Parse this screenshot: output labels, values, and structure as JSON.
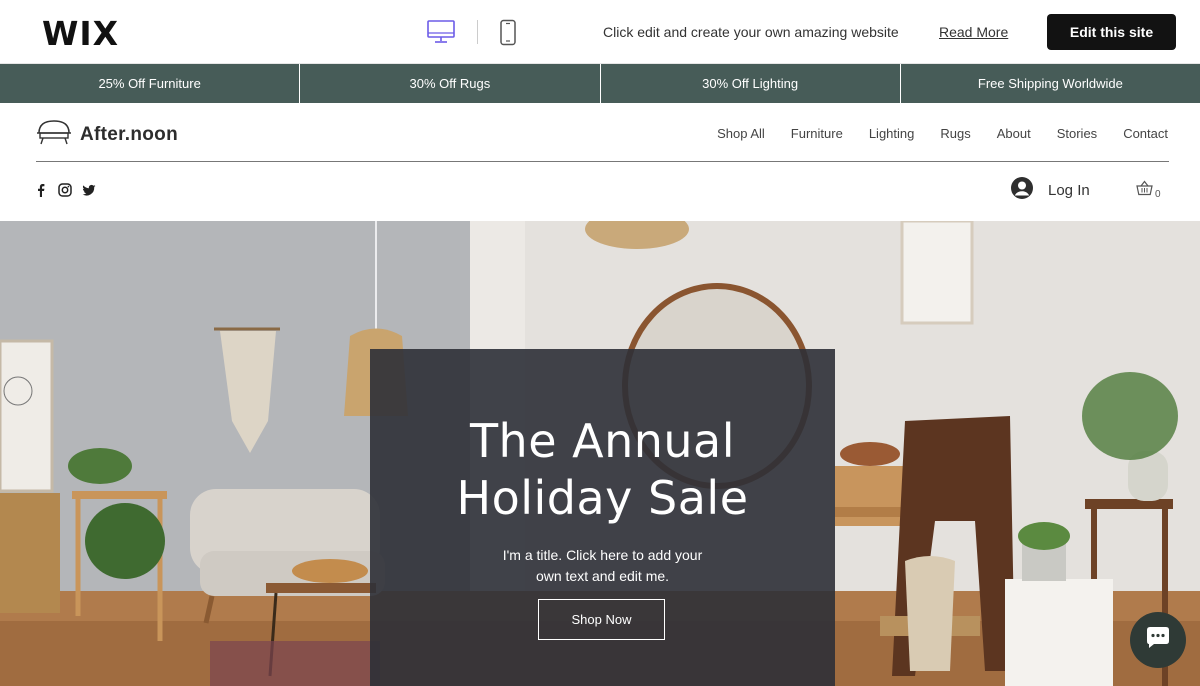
{
  "wixbar": {
    "logo": "WIX",
    "promo_text": "Click edit and create your own amazing website",
    "read_more": "Read More",
    "edit_button": "Edit this site",
    "desktop_icon": "desktop-icon",
    "mobile_icon": "mobile-icon"
  },
  "promo_strip": {
    "items": [
      "25% Off Furniture",
      "30% Off Rugs",
      "30% Off Lighting",
      "Free Shipping Worldwide"
    ],
    "color": "#475c58"
  },
  "site": {
    "logo_text": "After.noon",
    "nav": [
      "Shop All",
      "Furniture",
      "Lighting",
      "Rugs",
      "About",
      "Stories",
      "Contact"
    ],
    "socials": [
      "facebook-icon",
      "instagram-icon",
      "twitter-icon"
    ],
    "login": "Log In",
    "cart_count": "0"
  },
  "hero": {
    "title_line1": "The Annual",
    "title_line2": "Holiday Sale",
    "subtitle_line1": "I'm a title. Click here to add your",
    "subtitle_line2": "own text and edit me.",
    "button": "Shop Now"
  },
  "colors": {
    "accent_dark": "#121212",
    "promo_green": "#475c58",
    "hero_panel": "#2d3037"
  }
}
